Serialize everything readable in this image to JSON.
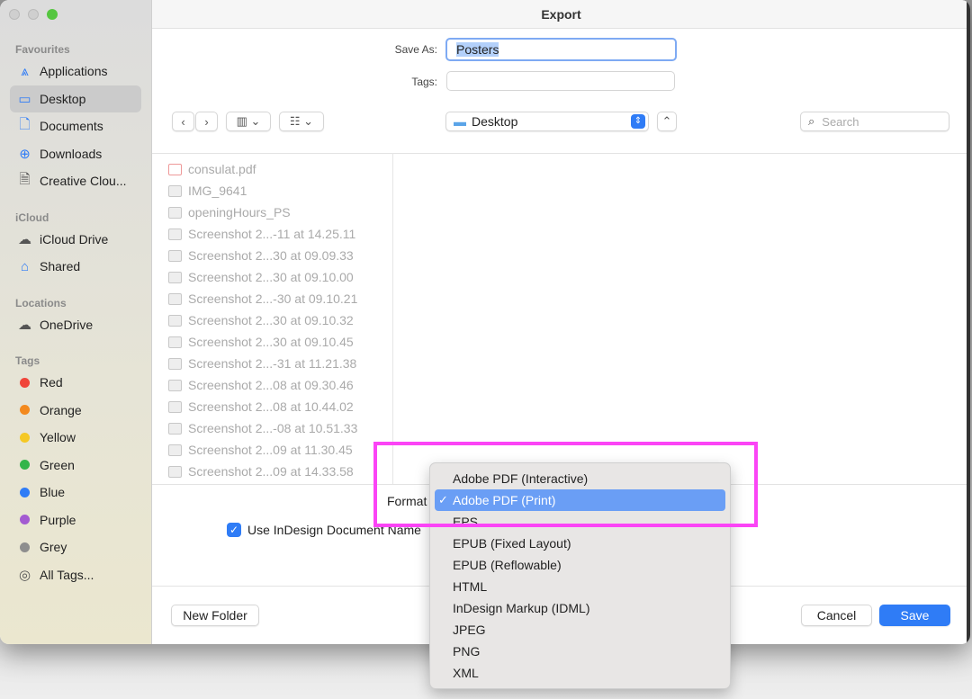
{
  "window": {
    "title": "Export"
  },
  "sidebar": {
    "sections": [
      {
        "title": "Favourites",
        "items": [
          {
            "label": "Applications",
            "icon": "applications-icon"
          },
          {
            "label": "Desktop",
            "icon": "desktop-icon",
            "selected": true
          },
          {
            "label": "Documents",
            "icon": "document-icon"
          },
          {
            "label": "Downloads",
            "icon": "download-icon"
          },
          {
            "label": "Creative Clou...",
            "icon": "file-icon"
          }
        ]
      },
      {
        "title": "iCloud",
        "items": [
          {
            "label": "iCloud Drive",
            "icon": "cloud-icon"
          },
          {
            "label": "Shared",
            "icon": "shared-folder-icon"
          }
        ]
      },
      {
        "title": "Locations",
        "items": [
          {
            "label": "OneDrive",
            "icon": "cloud-icon"
          }
        ]
      },
      {
        "title": "Tags",
        "items": [
          {
            "label": "Red",
            "color": "#f0453a"
          },
          {
            "label": "Orange",
            "color": "#f3891e"
          },
          {
            "label": "Yellow",
            "color": "#f5c824"
          },
          {
            "label": "Green",
            "color": "#33b54a"
          },
          {
            "label": "Blue",
            "color": "#2f7cf6"
          },
          {
            "label": "Purple",
            "color": "#a35bd1"
          },
          {
            "label": "Grey",
            "color": "#8e8e8e"
          },
          {
            "label": "All Tags...",
            "icon": "all-tags-icon"
          }
        ]
      }
    ]
  },
  "form": {
    "save_as_label": "Save As:",
    "save_as_value": "Posters",
    "tags_label": "Tags:",
    "tags_value": ""
  },
  "toolbar": {
    "location": "Desktop",
    "search_placeholder": "Search"
  },
  "files": [
    "consulat.pdf",
    "IMG_9641",
    "openingHours_PS",
    "Screenshot 2...-11 at 14.25.11",
    "Screenshot 2...30 at 09.09.33",
    "Screenshot 2...30 at 09.10.00",
    "Screenshot 2...-30 at 09.10.21",
    "Screenshot 2...30 at 09.10.32",
    "Screenshot 2...30 at 09.10.45",
    "Screenshot 2...-31 at 11.21.38",
    "Screenshot 2...08 at 09.30.46",
    "Screenshot 2...08 at 10.44.02",
    "Screenshot 2...-08 at 10.51.33",
    "Screenshot 2...09 at 11.30.45",
    "Screenshot 2...09 at 14.33.58"
  ],
  "options": {
    "format_label": "Format",
    "use_name_label": "Use InDesign Document Name",
    "use_name_checked": true
  },
  "format_menu": {
    "items": [
      "Adobe PDF (Interactive)",
      "Adobe PDF (Print)",
      "EPS",
      "EPUB (Fixed Layout)",
      "EPUB (Reflowable)",
      "HTML",
      "InDesign Markup (IDML)",
      "JPEG",
      "PNG",
      "XML"
    ],
    "selected": "Adobe PDF (Print)",
    "check": "✓"
  },
  "buttons": {
    "new_folder": "New Folder",
    "cancel": "Cancel",
    "save": "Save"
  },
  "colors": {
    "accent": "#2f7cf6",
    "highlight": "#fb44f6"
  }
}
